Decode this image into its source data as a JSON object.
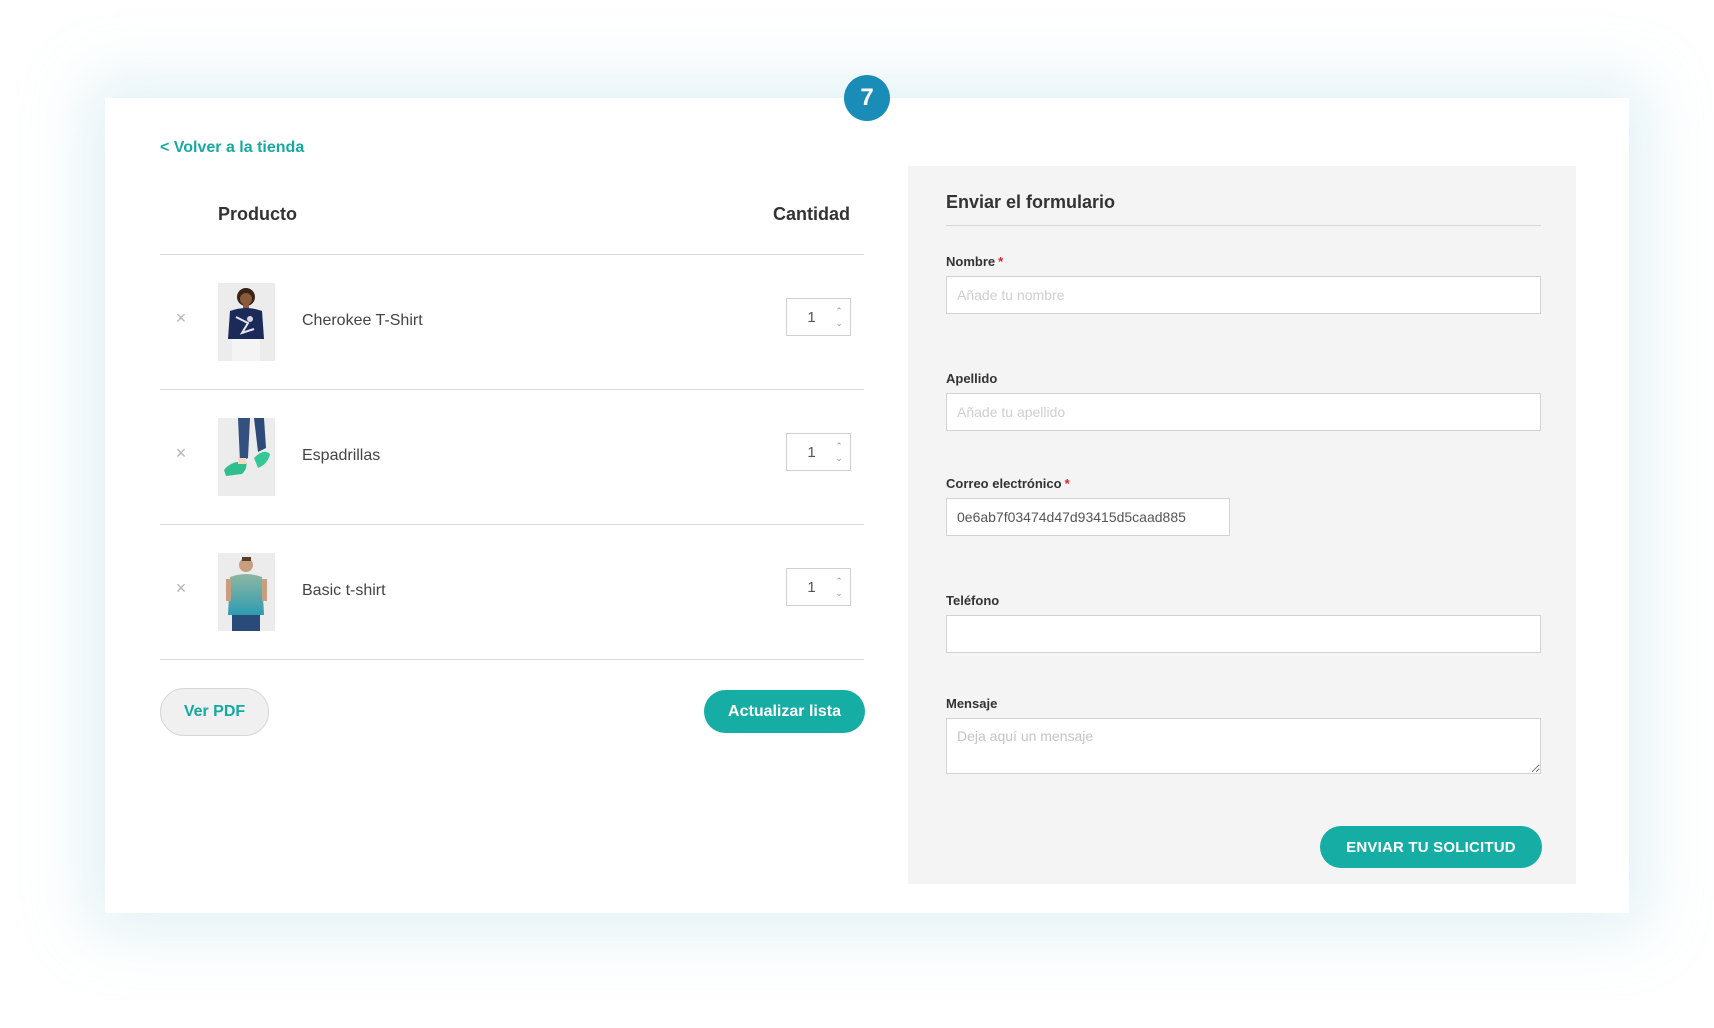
{
  "step_badge": "7",
  "back_link": "< Volver a la tienda",
  "cart": {
    "header_product": "Producto",
    "header_quantity": "Cantidad",
    "remove_icon": "×",
    "items": [
      {
        "name": "Cherokee T-Shirt",
        "quantity": "1",
        "image": "woman-navy-tshirt"
      },
      {
        "name": "Espadrillas",
        "quantity": "1",
        "image": "green-espadrilles"
      },
      {
        "name": "Basic t-shirt",
        "quantity": "1",
        "image": "man-gradient-tshirt"
      }
    ],
    "pdf_button": "Ver PDF",
    "update_button": "Actualizar lista"
  },
  "form": {
    "title": "Enviar el formulario",
    "required_mark": "*",
    "nombre": {
      "label": "Nombre",
      "placeholder": "Añade tu nombre",
      "value": ""
    },
    "apellido": {
      "label": "Apellido",
      "placeholder": "Añade tu apellido",
      "value": ""
    },
    "email": {
      "label": "Correo electrónico",
      "value": "0e6ab7f03474d47d93415d5caad885"
    },
    "telefono": {
      "label": "Teléfono",
      "value": ""
    },
    "mensaje": {
      "label": "Mensaje",
      "placeholder": "Deja aquí un mensaje"
    },
    "submit_button": "ENVIAR TU SOLICITUD"
  },
  "colors": {
    "accent": "#16ada4",
    "badge": "#1a8cb8",
    "required": "#e02424"
  }
}
